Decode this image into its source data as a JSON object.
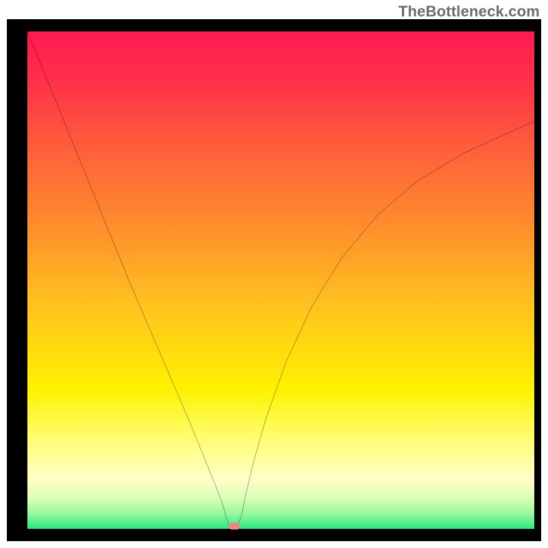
{
  "watermark": {
    "text": "TheBottleneck.com"
  },
  "chart_data": {
    "type": "line",
    "title": "",
    "xlabel": "",
    "ylabel": "",
    "xlim": [
      0,
      100
    ],
    "ylim": [
      0,
      100
    ],
    "grid": false,
    "legend": false,
    "gradient_stops": [
      {
        "offset": 0.0,
        "color": "#ff1a52"
      },
      {
        "offset": 0.1,
        "color": "#ff3149"
      },
      {
        "offset": 0.22,
        "color": "#ff5a3c"
      },
      {
        "offset": 0.38,
        "color": "#ff8a2e"
      },
      {
        "offset": 0.55,
        "color": "#ffc21e"
      },
      {
        "offset": 0.72,
        "color": "#fff200"
      },
      {
        "offset": 0.82,
        "color": "#fffd73"
      },
      {
        "offset": 0.9,
        "color": "#ffffc8"
      },
      {
        "offset": 0.94,
        "color": "#d8ffb4"
      },
      {
        "offset": 0.97,
        "color": "#96f7a0"
      },
      {
        "offset": 1.0,
        "color": "#28e97c"
      }
    ],
    "series": [
      {
        "name": "bottleneck-curve",
        "color": "#000000",
        "x": [
          0.0,
          4.0,
          8.0,
          12.0,
          16.0,
          20.0,
          24.0,
          28.0,
          32.0,
          35.0,
          37.0,
          38.5,
          39.2,
          39.9,
          41.5,
          42.3,
          43.1,
          44.5,
          47.0,
          51.0,
          56.0,
          62.0,
          69.0,
          77.0,
          86.0,
          100.0
        ],
        "y": [
          100.0,
          90.0,
          80.0,
          70.0,
          60.0,
          50.0,
          40.5,
          31.0,
          21.5,
          14.0,
          9.0,
          5.0,
          2.3,
          0.5,
          0.5,
          3.0,
          7.0,
          13.0,
          22.0,
          33.5,
          44.5,
          54.5,
          63.0,
          70.0,
          75.5,
          82.0
        ]
      }
    ],
    "marker": {
      "name": "selected-point",
      "color": "#e48a8a",
      "x": 40.8,
      "y": 0.5
    }
  }
}
